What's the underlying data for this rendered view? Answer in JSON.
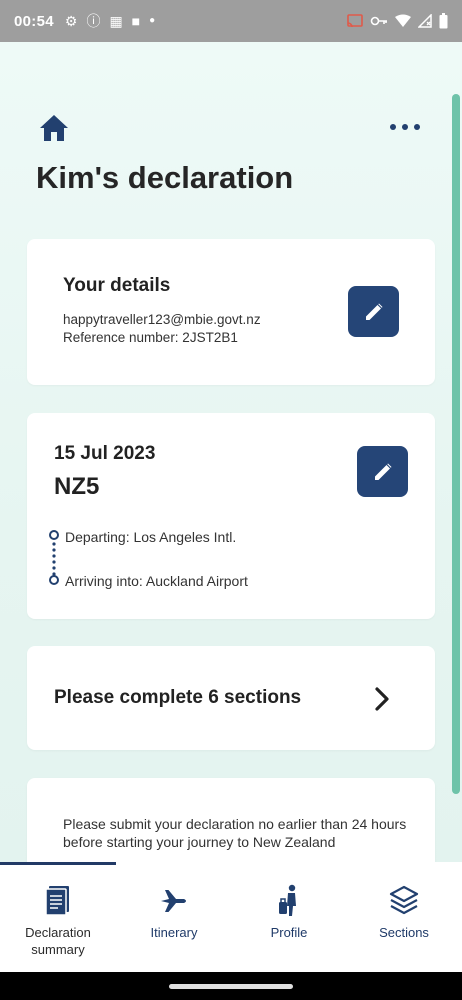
{
  "status_bar": {
    "time": "00:54",
    "left_icons": [
      "gear-icon",
      "info-icon",
      "grid-icon",
      "square-icon",
      "dot-icon"
    ],
    "right_icons": [
      "cast-icon",
      "key-icon",
      "wifi-icon",
      "signal-icon",
      "battery-icon"
    ]
  },
  "header": {
    "title": "Kim's declaration"
  },
  "details_card": {
    "heading": "Your details",
    "email": "happytraveller123@mbie.govt.nz",
    "reference": "Reference number:  2JST2B1"
  },
  "flight_card": {
    "date": "15 Jul 2023",
    "flight_number": "NZ5",
    "departing": "Departing: Los Angeles Intl.",
    "arriving": "Arriving into: Auckland Airport"
  },
  "sections_card": {
    "label": "Please complete 6 sections"
  },
  "notice_card": {
    "text": "Please submit your declaration no earlier than 24 hours before starting your journey to New Zealand"
  },
  "bottom_nav": {
    "items": [
      {
        "label": "Declaration summary",
        "icon": "document-icon",
        "active": true
      },
      {
        "label": "Itinerary",
        "icon": "airplane-icon",
        "active": false
      },
      {
        "label": "Profile",
        "icon": "traveller-icon",
        "active": false
      },
      {
        "label": "Sections",
        "icon": "layers-icon",
        "active": false
      }
    ]
  },
  "colors": {
    "accent": "#254577",
    "background": "#eefaf7",
    "scrollbar": "#6ec3a9"
  }
}
